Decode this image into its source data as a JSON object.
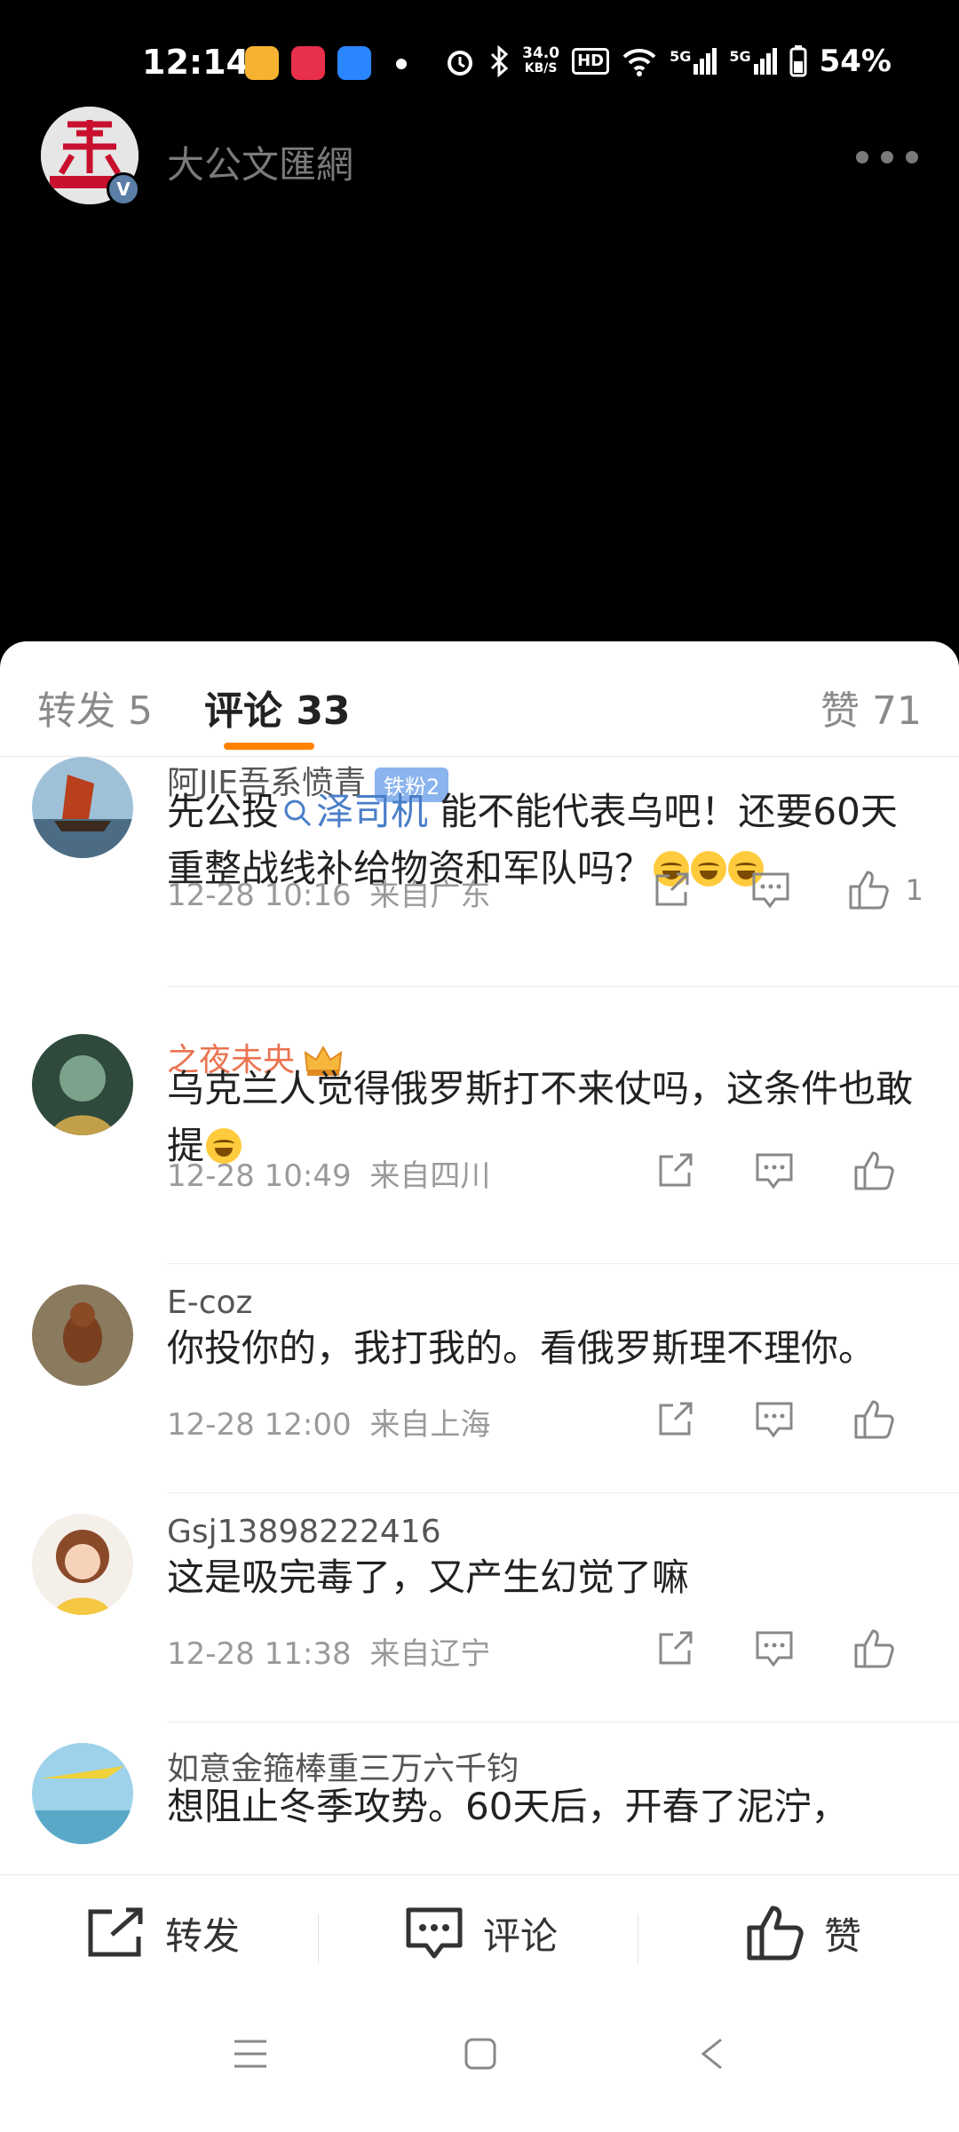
{
  "status_bar": {
    "time": "12:14",
    "speed_value": "34.0",
    "speed_unit": "KB/S",
    "hd_label": "HD",
    "net1": "5G",
    "net2": "5G",
    "battery": "54%"
  },
  "header": {
    "account_name": "大公文匯網",
    "avatar_icon": "dagong-logo",
    "verified_label": "V"
  },
  "tabs": [
    {
      "label": "转发 5"
    },
    {
      "label": "评论 33",
      "active": true
    },
    {
      "label": "赞 71"
    }
  ],
  "comments": [
    {
      "user": "阿JIE吾系愤青",
      "badge": "铁粉2",
      "text_before": "先公投",
      "link": "泽司机",
      "text_after": " 能不能代表乌吧！还要60天重整战线补给物资和军队吗？",
      "time": "12-28 10:16",
      "location": "来自广东",
      "likes": "1"
    },
    {
      "user": "之夜未央",
      "text": "乌克兰人觉得俄罗斯打不来仗吗，这条件也敢提",
      "time": "12-28 10:49",
      "location": "来自四川"
    },
    {
      "user": "E-coz",
      "text": "你投你的，我打我的。看俄罗斯理不理你。",
      "time": "12-28 12:00",
      "location": "来自上海"
    },
    {
      "user": "Gsj13898222416",
      "text": "这是吸完毒了，又产生幻觉了嘛",
      "time": "12-28 11:38",
      "location": "来自辽宁"
    },
    {
      "user": "如意金箍棒重三万六千钧",
      "text": "想阻止冬季攻势。60天后，开春了泥泞，"
    }
  ],
  "bottom_bar": {
    "repost": "转发",
    "comment": "评论",
    "like": "赞"
  },
  "colors": {
    "accent": "#ff8200",
    "link": "#4a7ec8",
    "vip_name": "#eb7350"
  }
}
